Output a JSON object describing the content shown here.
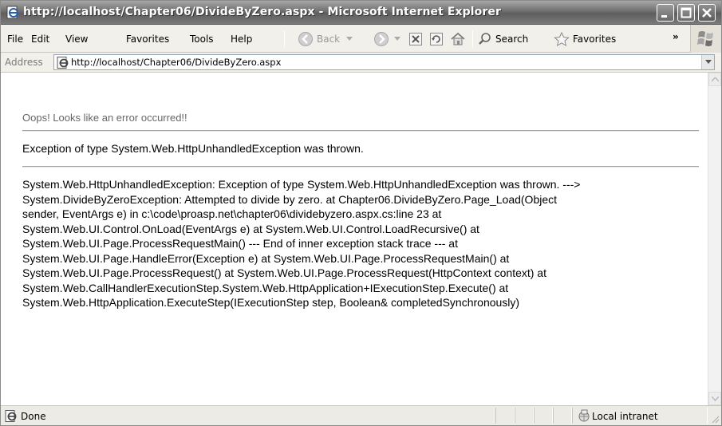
{
  "window": {
    "title": "http://localhost/Chapter06/DivideByZero.aspx - Microsoft Internet Explorer"
  },
  "menu": [
    {
      "label": "File"
    },
    {
      "label": "Edit"
    },
    {
      "label": "View"
    },
    {
      "label": "Favorites"
    },
    {
      "label": "Tools"
    },
    {
      "label": "Help"
    }
  ],
  "toolbar": {
    "back_label": "Back",
    "search_label": "Search",
    "favorites_label": "Favorites",
    "chevron": "»"
  },
  "address": {
    "label": "Address",
    "url": "http://localhost/Chapter06/DivideByZero.aspx"
  },
  "page": {
    "oops": "Oops! Looks like an error occurred!!",
    "exception_title": "Exception of type System.Web.HttpUnhandledException was thrown.",
    "stack_lines": [
      "System.Web.HttpUnhandledException: Exception of type System.Web.HttpUnhandledException was thrown. --->",
      "System.DivideByZeroException: Attempted to divide by zero. at Chapter06.DivideByZero.Page_Load(Object",
      "sender, EventArgs e) in c:\\code\\proasp.net\\chapter06\\dividebyzero.aspx.cs:line 23 at",
      "System.Web.UI.Control.OnLoad(EventArgs e) at System.Web.UI.Control.LoadRecursive() at",
      "System.Web.UI.Page.ProcessRequestMain() --- End of inner exception stack trace --- at",
      "System.Web.UI.Page.HandleError(Exception e) at System.Web.UI.Page.ProcessRequestMain() at",
      "System.Web.UI.Page.ProcessRequest() at System.Web.UI.Page.ProcessRequest(HttpContext context) at",
      "System.Web.CallHandlerExecutionStep.System.Web.HttpApplication+IExecutionStep.Execute() at",
      "System.Web.HttpApplication.ExecuteStep(IExecutionStep step, Boolean& completedSynchronously)"
    ]
  },
  "status": {
    "text": "Done",
    "zone": "Local intranet"
  },
  "icons": {
    "title": "ie-page-icon",
    "minimize": "minimize-icon",
    "maximize": "maximize-icon",
    "close": "close-icon",
    "back": "back-arrow-icon",
    "forward": "forward-arrow-icon",
    "stop": "stop-icon",
    "refresh": "refresh-icon",
    "home": "home-icon",
    "search": "search-icon",
    "favorites": "star-icon",
    "windows_logo": "windows-logo-icon",
    "zone": "intranet-icon"
  }
}
